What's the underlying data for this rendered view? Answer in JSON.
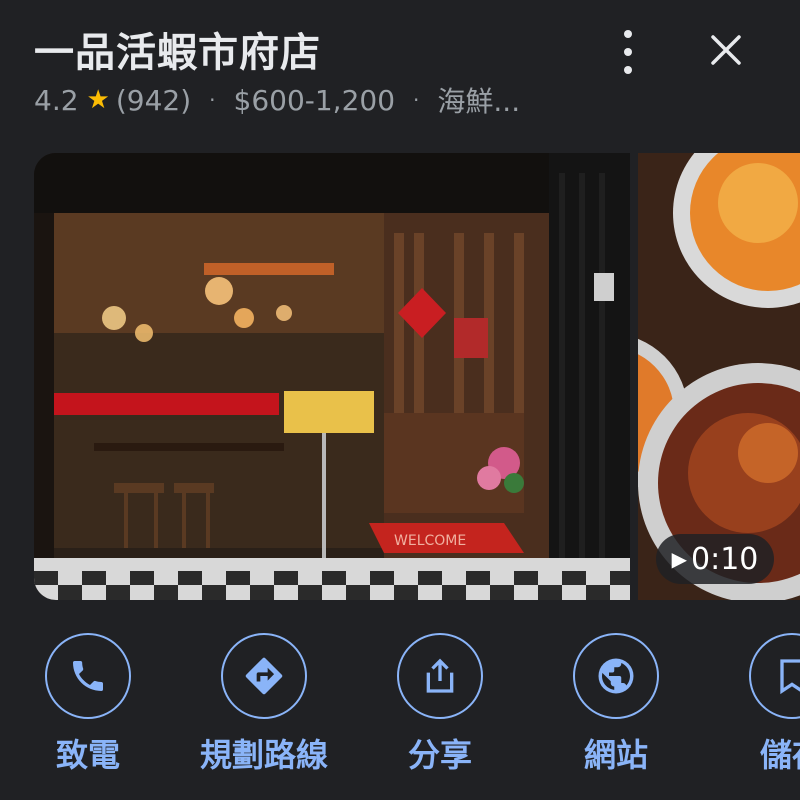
{
  "place": {
    "name": "一品活蝦市府店",
    "rating": "4.2",
    "review_count": "(942)",
    "price": "$600-1,200",
    "category": "海鮮..."
  },
  "icons": {
    "more": "more-vert-icon",
    "close": "close-icon",
    "star": "star-icon"
  },
  "photos": {
    "video_duration": "0:10",
    "storefront_sign": "WELCOME"
  },
  "actions": [
    {
      "label": "致電",
      "icon": "phone-icon"
    },
    {
      "label": "規劃路線",
      "icon": "directions-icon"
    },
    {
      "label": "分享",
      "icon": "share-icon"
    },
    {
      "label": "網站",
      "icon": "globe-icon"
    },
    {
      "label": "儲存",
      "icon": "bookmark-icon"
    }
  ],
  "colors": {
    "background": "#202124",
    "accent": "#8ab4f8",
    "star": "#fbbc04",
    "text_primary": "#e8eaed",
    "text_secondary": "#9aa0a6"
  }
}
